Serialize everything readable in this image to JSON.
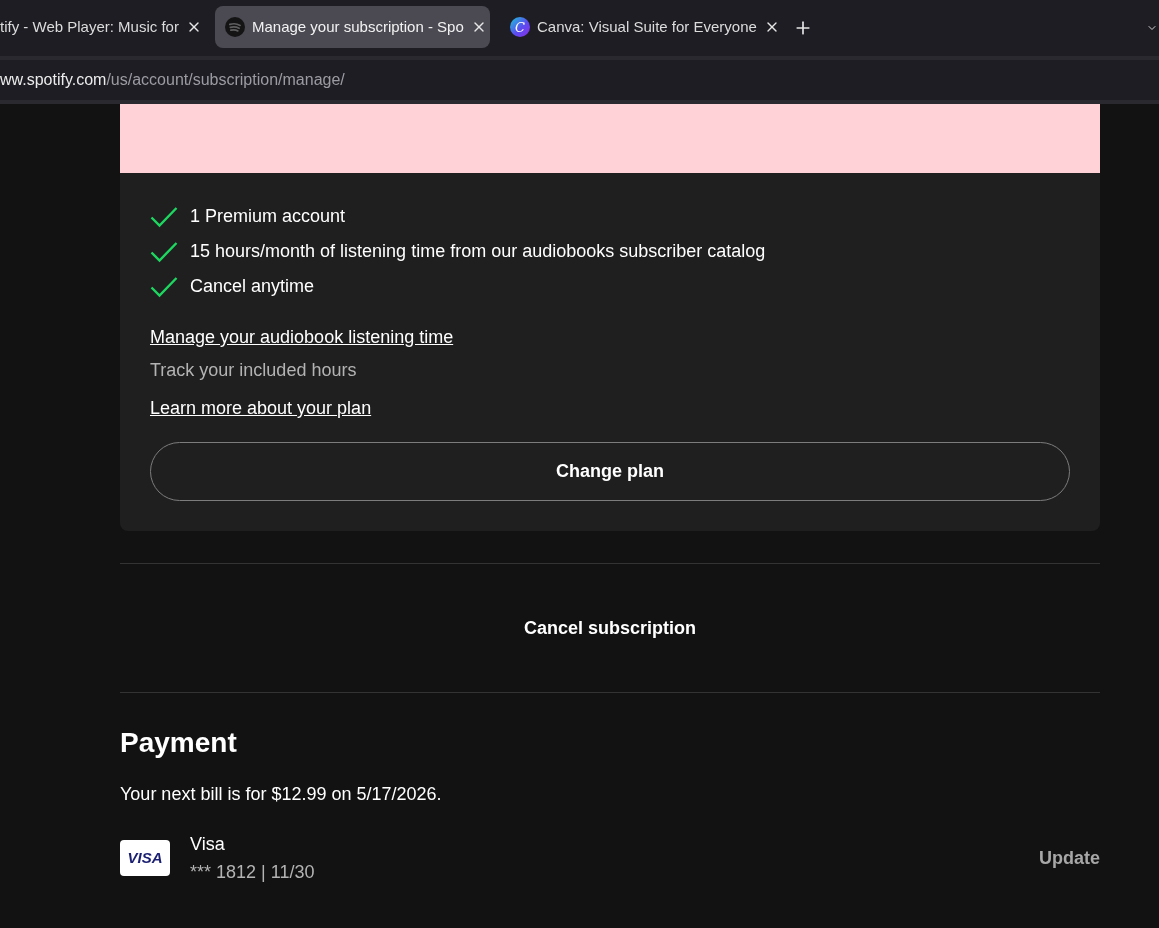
{
  "browser": {
    "tabs": [
      {
        "kind": "plain",
        "title": "tify - Web Player: Music for",
        "selected": false
      },
      {
        "kind": "waves",
        "title": "Manage your subscription - Spo",
        "selected": true
      },
      {
        "kind": "letter",
        "icon_text": "C",
        "title": "Canva: Visual Suite for Everyone",
        "selected": false
      }
    ],
    "address": {
      "host": "ww.spotify.com",
      "path": "/us/account/subscription/manage/"
    }
  },
  "plan_card": {
    "features": [
      "1 Premium account",
      "15 hours/month of listening time from our audiobooks subscriber catalog",
      "Cancel anytime"
    ],
    "audiobook_link": "Manage your audiobook listening time",
    "audiobook_note": "Track your included hours",
    "plan_link": "Learn more about your plan",
    "change_button": "Change plan"
  },
  "cancel_button": "Cancel subscription",
  "payment": {
    "title": "Payment",
    "next_bill": "Your next bill is for $12.99 on 5/17/2026.",
    "card": {
      "logo": "VISA",
      "brand": "Visa",
      "details": "*** 1812 | 11/30",
      "action": "Update"
    }
  }
}
